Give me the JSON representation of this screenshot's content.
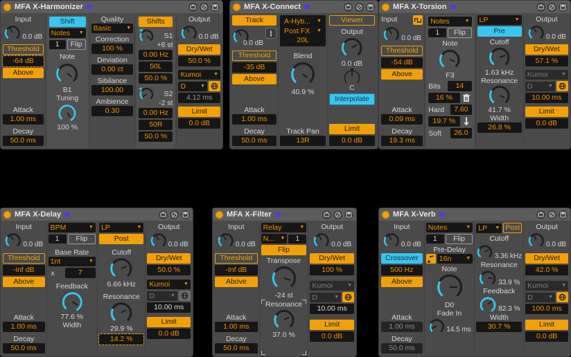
{
  "devices": [
    {
      "id": "x-harmonizer",
      "title": "MFA X-Harmonizer",
      "input": {
        "label": "Input",
        "value": "0.0 dB",
        "knob": 0.12
      },
      "threshold": {
        "label": "Threshold",
        "value": "-64 dB",
        "mode": "Above"
      },
      "attack": {
        "label": "Attack",
        "value": "1.00 ms"
      },
      "decay": {
        "label": "Decay",
        "value": "50.0 ms"
      },
      "mode_button": "Shift",
      "source_dd": "Notes",
      "voice_num": "1",
      "flip": "Flip",
      "note": {
        "label": "Note",
        "value": "B1",
        "knob": 0.55
      },
      "tuning": {
        "label": "Tuning",
        "value": "100 %",
        "knob": 0.72
      },
      "quality": {
        "label": "Quality",
        "value": "Basic"
      },
      "correction": {
        "label": "Correction",
        "value": "100 %"
      },
      "deviation": {
        "label": "Deviation",
        "value": "0.00 ct"
      },
      "sibilance": {
        "label": "Sibilance",
        "value": "100.00"
      },
      "ambience": {
        "label": "Ambience",
        "value": "0.30"
      },
      "shifts_button": "Shifts",
      "s1": {
        "name": "S1",
        "semitones": "+8 st",
        "rate": "0.00 Hz",
        "pan": "50L",
        "amount": "50.0 %",
        "knob": 0.62
      },
      "s2": {
        "name": "S2",
        "semitones": "-2 st",
        "rate": "0.00 Hz",
        "pan": "50R",
        "amount": "50.0 %",
        "knob": 0.52
      },
      "output": {
        "label": "Output",
        "value": "0.0 dB",
        "knob": 0.12
      },
      "drywet": {
        "label": "Dry/Wet",
        "value": "50.0 %"
      },
      "scale": "Kumoi",
      "root": "D",
      "glide": "4.12 ms",
      "limit": {
        "label": "Limit",
        "value": "0.0 dB"
      }
    },
    {
      "id": "x-connect",
      "title": "MFA X-Connect",
      "track_button": "Track",
      "input": {
        "value": "0.0 dB",
        "knob": 0.12
      },
      "threshold": {
        "label": "Threshold",
        "value": "-35 dB",
        "mode": "Above"
      },
      "attack": {
        "label": "Attack",
        "value": "1.00 ms"
      },
      "decay": {
        "label": "Decay",
        "value": "50.0 ms"
      },
      "routing_dd": "A-Hyb...",
      "point_dd": "Post FX",
      "routing_pan": "20L",
      "blend": {
        "label": "Blend",
        "value": "40.9 %",
        "knob": 0.45
      },
      "track_pan": {
        "label": "Track Pan",
        "value": "13R"
      },
      "viewer_button": "Viewer",
      "output": {
        "label": "Output",
        "value": "0.0 dB",
        "knob": 0.33
      },
      "pan": {
        "value": "C",
        "knob": 0.5
      },
      "interpolate": "Interpolate",
      "limit": {
        "label": "Limit",
        "value": "0.0 dB"
      }
    },
    {
      "id": "x-torsion",
      "title": "MFA X-Torsion",
      "input": {
        "label": "Input",
        "value": "0.0 dB",
        "knob": 0.12
      },
      "threshold": {
        "label": "Threshold",
        "value": "-54 dB",
        "mode": "Above"
      },
      "attack": {
        "label": "Attack",
        "value": "0.09 ms"
      },
      "decay": {
        "label": "Decay",
        "value": "19.3 ms"
      },
      "source_dd": "Notes",
      "voice_num": "1",
      "flip": "Flip",
      "note": {
        "label": "Note",
        "value": "F3",
        "knob": 0.58
      },
      "bits": {
        "label": "Bits",
        "value": "14",
        "pct": "16 %"
      },
      "hard": {
        "label": "Hard",
        "value": "7.60",
        "pct": "19.7 %"
      },
      "soft": {
        "label": "Soft",
        "value": "26.0"
      },
      "filter_dd": "LP",
      "pre_button": "Pre",
      "cutoff": {
        "label": "Cutoff",
        "value": "1.63 kHz",
        "knob": 0.62
      },
      "resonance": {
        "label": "Resonance",
        "value": "41.7 %",
        "knob": 0.55
      },
      "width": {
        "label": "Width",
        "value": "26.8 %"
      },
      "output": {
        "label": "Output",
        "value": "0.0 dB",
        "knob": 0.12
      },
      "drywet": {
        "label": "Dry/Wet",
        "value": "57.1 %"
      },
      "scale": "Kumoi",
      "root": "D",
      "glide": "10.00 ms",
      "limit": {
        "label": "Limit",
        "value": "0.0 dB"
      }
    },
    {
      "id": "x-delay",
      "title": "MFA X-Delay",
      "input": {
        "label": "Input",
        "value": "0.0 dB",
        "knob": 0.12
      },
      "threshold": {
        "label": "Threshold",
        "value": "-inf dB",
        "mode": "Above"
      },
      "attack": {
        "label": "Attack",
        "value": "1.00 ms"
      },
      "decay": {
        "label": "Decay",
        "value": "50.0 ms"
      },
      "source_dd": "BPM",
      "voice_num": "1",
      "flip": "Flip",
      "base_rate": {
        "label": "Base Rate",
        "value": "1nt",
        "mult_label": "x",
        "mult": "7"
      },
      "feedback": {
        "label": "Feedback",
        "value": "77.6 %",
        "knob": 0.72
      },
      "width": {
        "label": "Width",
        "value": "14.2 %"
      },
      "filter_dd": "LP",
      "post_button": "Post",
      "cutoff": {
        "label": "Cutoff",
        "value": "6.66 kHz",
        "knob": 0.66
      },
      "resonance": {
        "label": "Resonance",
        "value": "29.9 %",
        "knob": 0.48
      },
      "output": {
        "label": "Output",
        "value": "0.0 dB",
        "knob": 0.12
      },
      "drywet": {
        "label": "Dry/Wet",
        "value": "50.0 %"
      },
      "scale": "Kumoi",
      "root": "D",
      "glide": "10.00 ms",
      "limit": {
        "label": "Limit",
        "value": "0.0 dB"
      }
    },
    {
      "id": "x-filter",
      "title": "MFA X-Filter",
      "input": {
        "label": "Input",
        "value": "0.0 dB",
        "knob": 0.12
      },
      "threshold": {
        "label": "Threshold",
        "value": "-Inf dB",
        "mode": "Above"
      },
      "attack": {
        "label": "Attack",
        "value": "1.00 ms"
      },
      "decay": {
        "label": "Decay",
        "value": "50.0 ms"
      },
      "mode_dd": "Relay",
      "source_dd": "N...",
      "voice_num": "1",
      "flip": "Flip",
      "transpose": {
        "label": "Transpose",
        "value": "-24 st",
        "knob": 0.52
      },
      "resonance": {
        "label": "Resonance",
        "value": "37.0 %",
        "knob": 0.55
      },
      "output": {
        "label": "Output",
        "value": "0.0 dB",
        "knob": 0.12
      },
      "drywet": {
        "label": "Dry/Wet",
        "value": "100 %"
      },
      "scale": "Kumoi",
      "root": "D",
      "glide": "10.00 ms",
      "limit": {
        "label": "Limit",
        "value": "0.0 dB"
      }
    },
    {
      "id": "x-verb",
      "title": "MFA X-Verb",
      "input": {
        "label": "Input",
        "value": "0.0 dB",
        "knob": 0.12
      },
      "crossover": {
        "label": "Crossover",
        "value": "500 Hz",
        "mode": "Above"
      },
      "attack": {
        "label": "Attack",
        "value": "1.00 ms"
      },
      "decay": {
        "label": "Decay",
        "value": "50.0 ms"
      },
      "source_dd": "Notes",
      "voice_num": "1",
      "flip": "Flip",
      "predelay": {
        "label": "Pre-Delay",
        "value": "16n"
      },
      "note": {
        "label": "Note",
        "value": "D0",
        "knob": 0.5
      },
      "fade_in": {
        "label": "Fade In",
        "value": "14.5 ms",
        "knob": 0.1
      },
      "filter_dd": "LP",
      "post_button": "Post",
      "cutoff": {
        "label": "Cutoff",
        "value": "3.36 kHz",
        "knob": 0.6
      },
      "resonance": {
        "label": "Resonance",
        "value": "33.9 %",
        "knob": 0.5
      },
      "feedback": {
        "label": "Feedback",
        "value": "82.3 %",
        "knob": 0.7
      },
      "width": {
        "label": "Width",
        "value": "30.7 %"
      },
      "output": {
        "label": "Output",
        "value": "0.0 dB",
        "knob": 0.12
      },
      "drywet": {
        "label": "Dry/Wet",
        "value": "42.0 %"
      },
      "scale": "Kumoi",
      "root": "D",
      "glide": "100.0 ms",
      "limit": {
        "label": "Limit",
        "value": "0.0 dB"
      }
    }
  ],
  "colors": {
    "accent_orange": "#f2a007",
    "accent_cyan": "#38c6ef",
    "device_bg": "#4a4a4a",
    "title_bg": "#5c5c5c",
    "value_bg": "#161616",
    "led": "#f2a007",
    "blue_dot": "#4b3fe0"
  },
  "titlebar_icons": [
    "hide-icon",
    "bypass-icon",
    "save-icon"
  ]
}
